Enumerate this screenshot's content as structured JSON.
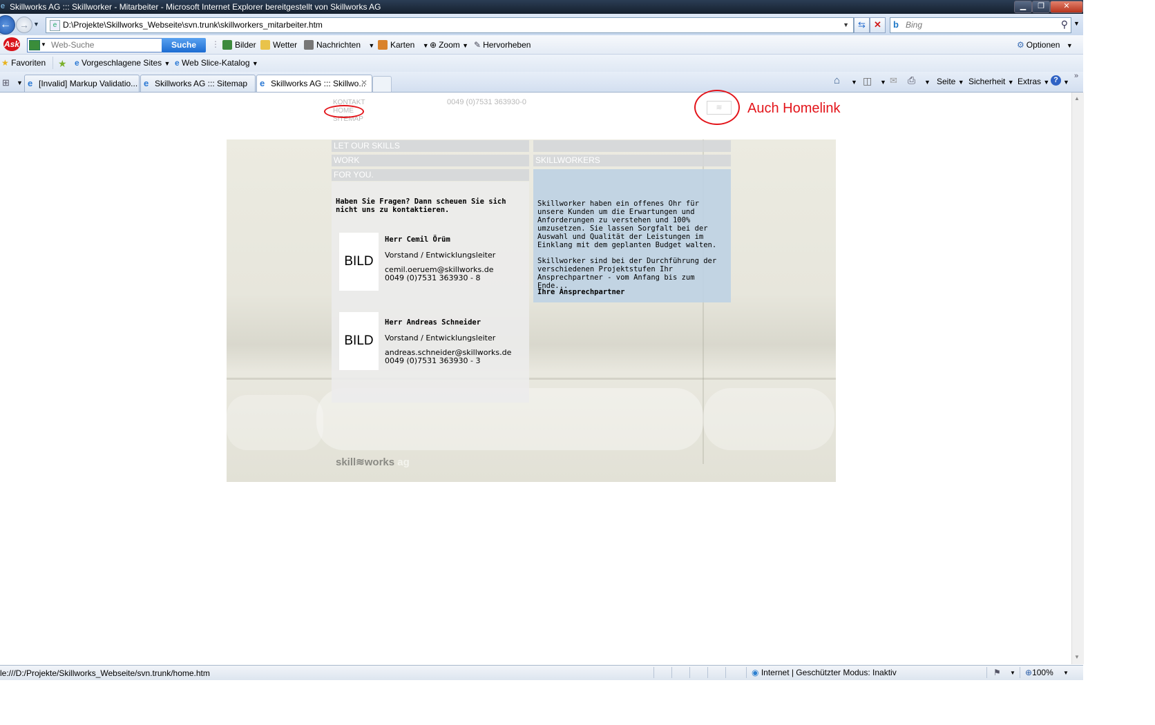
{
  "window": {
    "title": "Skillworks AG ::: Skillworker - Mitarbeiter - Microsoft Internet Explorer bereitgestellt von Skillworks AG",
    "minimize": "▁",
    "restore": "❐",
    "close": "✕"
  },
  "navigation": {
    "address": "D:\\Projekte\\Skillworks_Webseite\\svn.trunk\\skillworkers_mitarbeiter.htm",
    "search_placeholder": "Bing"
  },
  "ask_toolbar": {
    "logo": "Ask",
    "search_placeholder": "Web-Suche",
    "search_button": "Suche",
    "items": [
      "Bilder",
      "Wetter",
      "Nachrichten",
      "Karten",
      "Zoom",
      "Hervorheben"
    ],
    "options": "Optionen"
  },
  "favorites_bar": {
    "favorites": "Favoriten",
    "suggested": "Vorgeschlagene Sites",
    "webslice": "Web Slice-Katalog"
  },
  "tabs": [
    {
      "label": "[Invalid] Markup Validatio..."
    },
    {
      "label": "Skillworks AG ::: Sitemap"
    },
    {
      "label": "Skillworks AG ::: Skillwo..."
    }
  ],
  "command_bar": {
    "page": "Seite",
    "security": "Sicherheit",
    "extras": "Extras"
  },
  "page": {
    "nav": [
      "KONTAKT",
      "HOME",
      "SITEMAP"
    ],
    "phone": "0049 (0)7531 363930-0",
    "annotation": "Auch Homelink",
    "tagline": [
      "LET OUR SKILLS",
      "WORK",
      "FOR YOU."
    ],
    "right_header": "SKILLWORKERS",
    "contact_intro": "Haben Sie Fragen? Dann scheuen Sie sich nicht uns zu kontaktieren.",
    "contacts": [
      {
        "image_placeholder": "BILD",
        "name": "Herr Cemil Örüm",
        "role": "Vorstand / Entwicklungsleiter",
        "email": "cemil.oeruem@skillworks.de",
        "phone": "0049 (0)7531 363930 - 8"
      },
      {
        "image_placeholder": "BILD",
        "name": "Herr Andreas Schneider",
        "role": "Vorstand / Entwicklungsleiter",
        "email": "andreas.schneider@skillworks.de",
        "phone": "0049 (0)7531 363930 - 3"
      }
    ],
    "info_p1": "Skillworker haben ein offenes Ohr für unsere Kunden um die Erwartungen und Anforderungen zu verstehen und 100% umzusetzen. Sie lassen Sorgfalt bei der Auswahl und Qualität der Leistungen im Einklang mit dem geplanten Budget walten.",
    "info_p2": "Skillworker sind bei der Durchführung der verschiedenen Projektstufen Ihr Ansprechpartner - vom Anfang bis zum Ende...",
    "info_link": "Ihre Ansprechpartner",
    "brand_name": "skill≋works",
    "brand_suffix": "ag"
  },
  "status_bar": {
    "url": "le:///D:/Projekte/Skillworks_Webseite/svn.trunk/home.htm",
    "zone": "Internet | Geschützter Modus: Inaktiv",
    "zoom": "100%"
  },
  "colors": {
    "annotation_red": "#e3141a",
    "info_panel": "#bed1e3",
    "title_bar": "#15202e"
  }
}
